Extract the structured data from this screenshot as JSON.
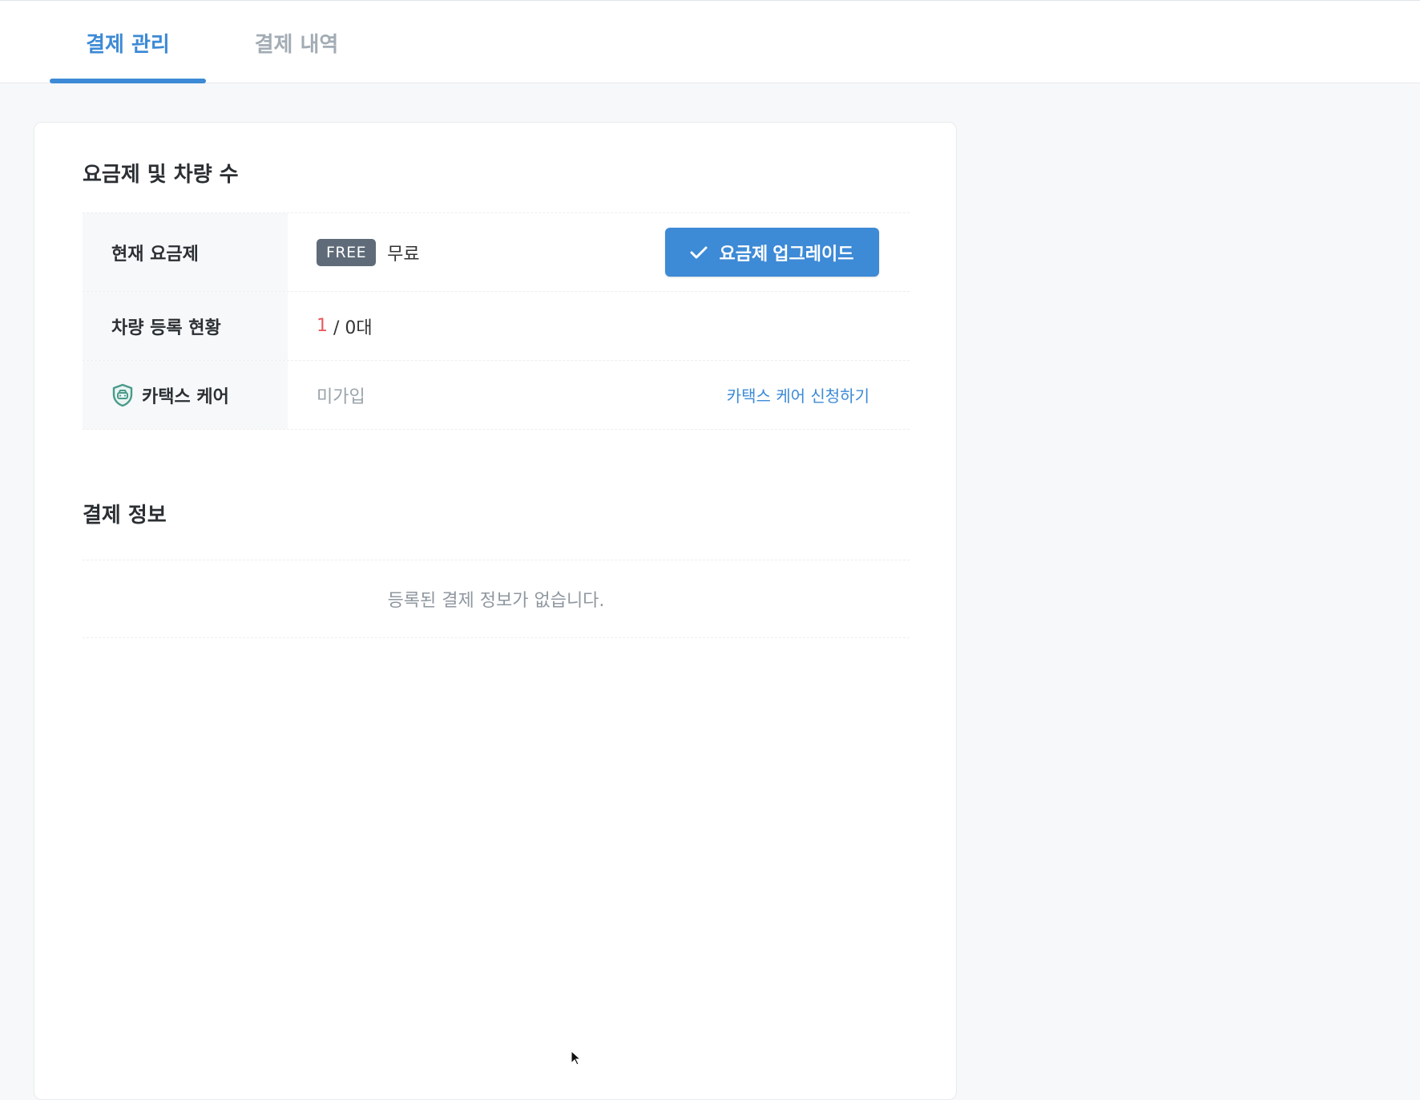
{
  "tabs": [
    {
      "label": "결제 관리",
      "active": true
    },
    {
      "label": "결제 내역",
      "active": false
    }
  ],
  "plan_section": {
    "title": "요금제 및 차량 수",
    "rows": {
      "current_plan": {
        "label": "현재 요금제",
        "badge": "FREE",
        "value": "무료",
        "upgrade_button": "요금제 업그레이드"
      },
      "vehicles": {
        "label": "차량 등록 현황",
        "registered": "1",
        "total": " / 0대"
      },
      "care": {
        "label": "카택스 케어",
        "status": "미가입",
        "apply_link": "카택스 케어 신청하기"
      }
    }
  },
  "payment_section": {
    "title": "결제 정보",
    "empty_message": "등록된 결제 정보가 없습니다."
  },
  "colors": {
    "accent": "#3d8ad6",
    "badge": "#5f6b78",
    "count_highlight": "#e85a5f",
    "shield": "#4a9a8c"
  }
}
